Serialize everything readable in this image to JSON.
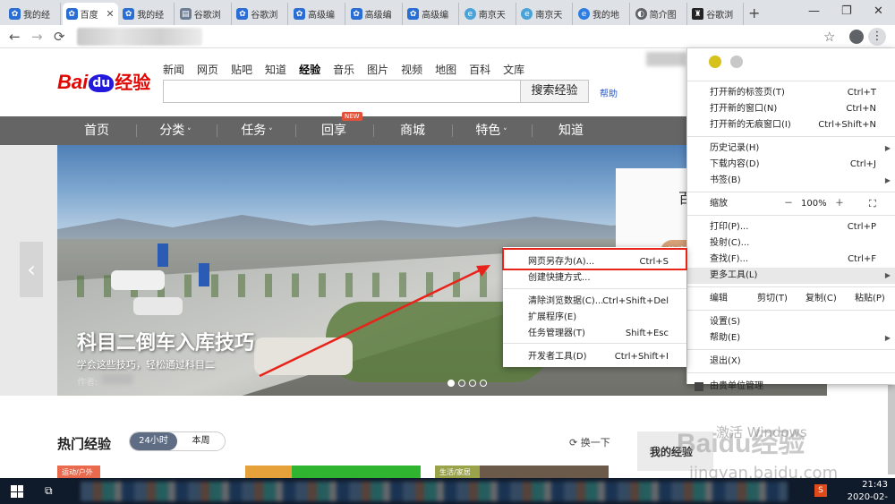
{
  "tabs": [
    {
      "label": "我的经",
      "icon": "paw"
    },
    {
      "label": "百度",
      "icon": "paw",
      "active": true
    },
    {
      "label": "我的经",
      "icon": "paw"
    },
    {
      "label": "谷歌浏",
      "icon": "doc"
    },
    {
      "label": "谷歌浏",
      "icon": "paw"
    },
    {
      "label": "高级编",
      "icon": "paw"
    },
    {
      "label": "高级编",
      "icon": "paw"
    },
    {
      "label": "高级编",
      "icon": "paw"
    },
    {
      "label": "南京天",
      "icon": "bird"
    },
    {
      "label": "南京天",
      "icon": "bird"
    },
    {
      "label": "我的地",
      "icon": "ie"
    },
    {
      "label": "简介图",
      "icon": "globe"
    },
    {
      "label": "谷歌浏",
      "icon": "pin"
    }
  ],
  "browser": {
    "new_tab": "+",
    "back": "←",
    "forward": "→",
    "reload": "⟳",
    "star": "☆",
    "kebab": "⋮",
    "minimize": "—",
    "restore": "❐",
    "close": "✕"
  },
  "baidu": {
    "logo_bai": "Bai",
    "logo_du": "du",
    "logo_jy": "经验",
    "topnav": [
      "新闻",
      "网页",
      "贴吧",
      "知道",
      "经验",
      "音乐",
      "图片",
      "视频",
      "地图",
      "百科",
      "文库"
    ],
    "topnav_current": 4,
    "search_button": "搜索经验",
    "help": "帮助"
  },
  "graynav": {
    "items": [
      "首页",
      "分类",
      "任务",
      "回享",
      "商城",
      "特色",
      "知道"
    ],
    "dropdown_items": [
      1,
      2,
      5
    ],
    "new_badge": "NEW"
  },
  "banner": {
    "title": "科目二倒车入库技巧",
    "subtitle": "学会这些技巧，轻松通过科目二",
    "author_label": "作者:",
    "promo_text": "百",
    "promo_button": "分享",
    "slide_count": 4,
    "active_slide": 0
  },
  "hot": {
    "title": "热门经验",
    "toggle": [
      "24小时",
      "本周"
    ],
    "refresh": "换一下",
    "my_box": "我的经验",
    "card_tags": [
      "运动/户外",
      "生活/家居"
    ]
  },
  "watermark": {
    "activate": "激活 Windows",
    "url": "jingyan.baidu.com",
    "logo": "Baidu经验"
  },
  "chrome_menu": {
    "items_top": [
      {
        "label": "打开新的标签页(T)",
        "shortcut": "Ctrl+T"
      },
      {
        "label": "打开新的窗口(N)",
        "shortcut": "Ctrl+N"
      },
      {
        "label": "打开新的无痕窗口(I)",
        "shortcut": "Ctrl+Shift+N"
      }
    ],
    "items_history": [
      {
        "label": "历史记录(H)",
        "shortcut": ""
      },
      {
        "label": "下载内容(D)",
        "shortcut": "Ctrl+J"
      },
      {
        "label": "书签(B)",
        "shortcut": ""
      }
    ],
    "zoom": {
      "label": "缩放",
      "minus": "－",
      "value": "100%",
      "plus": "＋",
      "fullscreen": "⛶"
    },
    "items_tools": [
      {
        "label": "打印(P)...",
        "shortcut": "Ctrl+P"
      },
      {
        "label": "投射(C)...",
        "shortcut": ""
      },
      {
        "label": "查找(F)...",
        "shortcut": "Ctrl+F"
      },
      {
        "label": "更多工具(L)",
        "shortcut": ""
      }
    ],
    "edit": {
      "label": "编辑",
      "cut": "剪切(T)",
      "copy": "复制(C)",
      "paste": "粘贴(P)"
    },
    "items_settings": [
      {
        "label": "设置(S)",
        "shortcut": ""
      },
      {
        "label": "帮助(E)",
        "shortcut": ""
      }
    ],
    "exit": "退出(X)",
    "managed": "由贵单位管理"
  },
  "more_tools_menu": {
    "items": [
      {
        "label": "网页另存为(A)...",
        "shortcut": "Ctrl+S"
      },
      {
        "label": "创建快捷方式...",
        "shortcut": ""
      },
      {
        "label": "清除浏览数据(C)...",
        "shortcut": "Ctrl+Shift+Del"
      },
      {
        "label": "扩展程序(E)",
        "shortcut": ""
      },
      {
        "label": "任务管理器(T)",
        "shortcut": "Shift+Esc"
      },
      {
        "label": "开发者工具(D)",
        "shortcut": "Ctrl+Shift+I"
      }
    ],
    "highlighted": 0
  },
  "taskbar": {
    "time": "21:43",
    "date": "2020-02-17",
    "tray_s": "S"
  },
  "colors": {
    "highlight_box": "#e8231a",
    "baidu_red": "#e10601",
    "baidu_blue": "#2319dc",
    "gray_nav": "#656565"
  }
}
